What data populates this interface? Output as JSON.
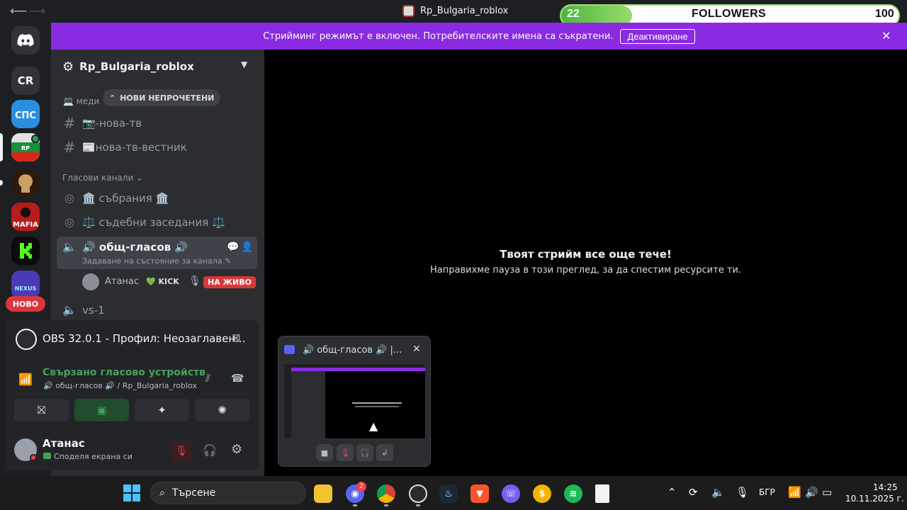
{
  "window": {
    "title": "Rp_Bulgaria_roblox"
  },
  "followers": {
    "current": "22",
    "label": "FOLLOWERS",
    "goal": "100",
    "progress_fraction": 0.22
  },
  "notice": {
    "text": "Стрийминг режимът е включен. Потребителските имена са съкратени.",
    "button": "Деактивиране"
  },
  "rail": {
    "user_initials": "CR",
    "new_label": "НОВО"
  },
  "server": {
    "name": "Rp_Bulgaria_roblox"
  },
  "unread_pill": "НОВИ НЕПРОЧЕТЕНИ",
  "channels": {
    "category_media_partial": "меди",
    "text": [
      {
        "name": "📷-нова-тв"
      },
      {
        "name": "📰нова-тв-вестник"
      }
    ],
    "voice_category": "Гласови канали",
    "voice": [
      {
        "name": "🏛️ събрания 🏛️"
      },
      {
        "name": "⚖️ съдебни заседания ⚖️"
      }
    ],
    "active_voice": {
      "name": "🔊 общ-гласов 🔊",
      "status_hint": "Задаване на състояние за канала",
      "member": "Атанас",
      "member_tag": "💚 KICK",
      "live_label": "НА ЖИВО"
    },
    "next_voice": {
      "name": "vs-1"
    }
  },
  "panel": {
    "obs_title": "OBS 32.0.1 - Профил: Неозаглавен...",
    "voice_connected": "Свързано гласово устройств",
    "voice_location": "🔊 общ-гласов 🔊 / Rp_Bulgaria_roblox",
    "username": "Атанас",
    "user_status": "Споделя екрана си"
  },
  "main": {
    "title": "Твоят стрийм все още тече!",
    "subtitle": "Направихме пауза в този преглед, за да спестим ресурсите ти."
  },
  "popout": {
    "title": "🔊 общ-гласов 🔊 |..."
  },
  "taskbar": {
    "search_placeholder": "Търсене",
    "discord_badge": "2",
    "language": "БГР",
    "time": "14:25",
    "date": "10.11.2025 г."
  },
  "colors": {
    "accent_notice": "#8a2be2",
    "live": "#da373c",
    "connected": "#43a25a",
    "followers_fill": "#4bb73a"
  },
  "icons": [
    "back-arrow-icon",
    "forward-arrow-icon",
    "discord-icon",
    "help-icon",
    "minimize-icon",
    "maximize-icon",
    "close-icon",
    "gear-icon",
    "chevron-down-icon",
    "hash-icon",
    "speaker-icon",
    "chat-icon",
    "add-member-icon",
    "screen-share-icon",
    "signal-icon",
    "noise-icon",
    "hangup-icon",
    "camera-off-icon",
    "activity-icon",
    "soundboard-icon",
    "mic-muted-icon",
    "headphones-icon",
    "settings-icon",
    "search-icon",
    "windows-start-icon"
  ]
}
